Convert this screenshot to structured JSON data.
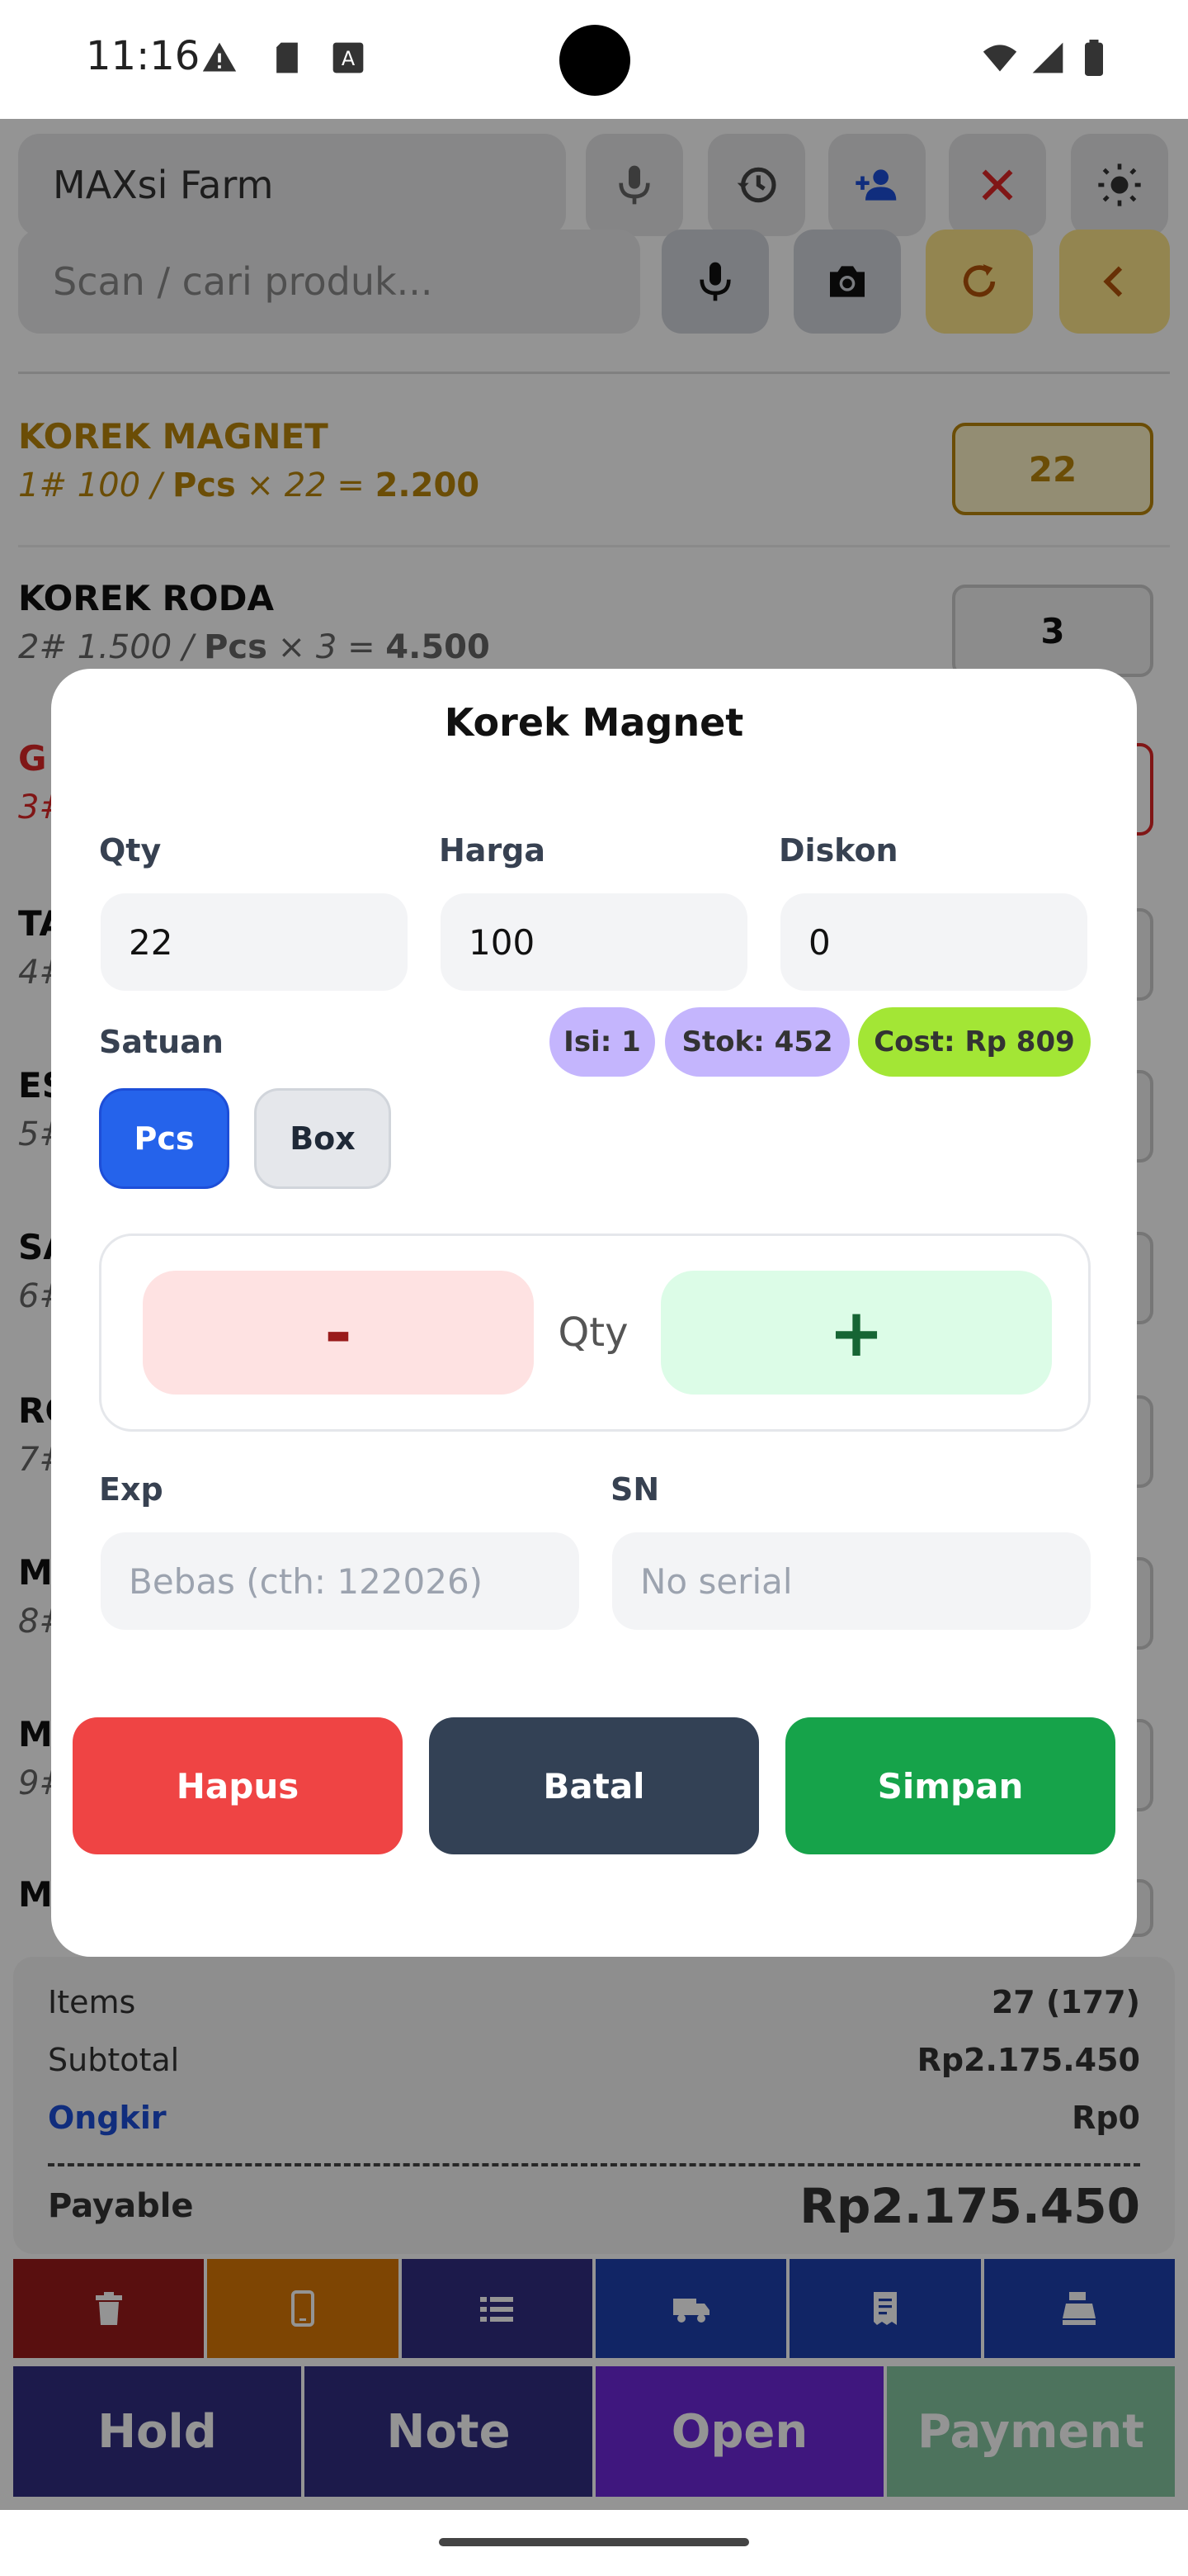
{
  "status_bar": {
    "time": "11:16",
    "icons": [
      "warning-icon",
      "sd-card-icon",
      "font-icon",
      "wifi-icon",
      "signal-icon",
      "battery-icon"
    ]
  },
  "toolbar": {
    "store_name": "MAXsi Farm",
    "search_placeholder": "Scan / cari produk...",
    "icons_row1": [
      "mic-icon",
      "history-icon",
      "add-person-icon",
      "close-icon",
      "brightness-icon"
    ],
    "icons_row2": [
      "mic-icon",
      "camera-icon",
      "refresh-icon",
      "back-icon"
    ]
  },
  "cart": {
    "items": [
      {
        "name": "KOREK MAGNET",
        "prefix": "1# 100 / ",
        "unit": "Pcs",
        "suffix": " × 22 = ",
        "total": "2.200",
        "qty": "22",
        "highlight": true
      },
      {
        "name": "KOREK RODA",
        "prefix": "2# 1.500 / ",
        "unit": "Pcs",
        "suffix": " × 3 = ",
        "total": "4.500",
        "qty": "3",
        "highlight": false
      }
    ],
    "partial_rows": [
      {
        "name": "G",
        "sub": "3#"
      },
      {
        "name": "TA",
        "sub": "4#"
      },
      {
        "name": "ES",
        "sub": "5#"
      },
      {
        "name": "SA",
        "sub": "6#"
      },
      {
        "name": "RC",
        "sub": "7#"
      },
      {
        "name": "M",
        "sub": "8#"
      },
      {
        "name": "M",
        "sub": "9#"
      },
      {
        "name": "M",
        "sub": ""
      }
    ]
  },
  "summary": {
    "items_label": "Items",
    "items_value": "27 (177)",
    "subtotal_label": "Subtotal",
    "subtotal_value": "Rp2.175.450",
    "ongkir_label": "Ongkir",
    "ongkir_value": "Rp0",
    "payable_label": "Payable",
    "payable_value": "Rp2.175.450"
  },
  "action_icons": [
    "trash-icon",
    "phone-icon",
    "list-icon",
    "truck-icon",
    "receipt-icon",
    "cash-register-icon"
  ],
  "action_buttons": {
    "hold": "Hold",
    "note": "Note",
    "open": "Open",
    "payment": "Payment"
  },
  "dialog": {
    "title": "Korek Magnet",
    "qty_label": "Qty",
    "qty_value": "22",
    "harga_label": "Harga",
    "harga_value": "100",
    "diskon_label": "Diskon",
    "diskon_value": "0",
    "satuan_label": "Satuan",
    "chip_isi": "Isi: 1",
    "chip_stok": "Stok: 452",
    "chip_cost": "Cost: Rp 809",
    "unit_pcs": "Pcs",
    "unit_box": "Box",
    "minus": "-",
    "stepper_label": "Qty",
    "plus": "+",
    "exp_label": "Exp",
    "exp_placeholder": "Bebas (cth: 122026)",
    "sn_label": "SN",
    "sn_placeholder": "No serial",
    "hapus": "Hapus",
    "batal": "Batal",
    "simpan": "Simpan"
  },
  "colors": {
    "accent_gold": "#b8860b",
    "selected_unit": "#2563eb",
    "hapus": "#ef4444",
    "batal": "#334155",
    "simpan": "#16a34a",
    "ongkir": "#1d4ed8"
  }
}
